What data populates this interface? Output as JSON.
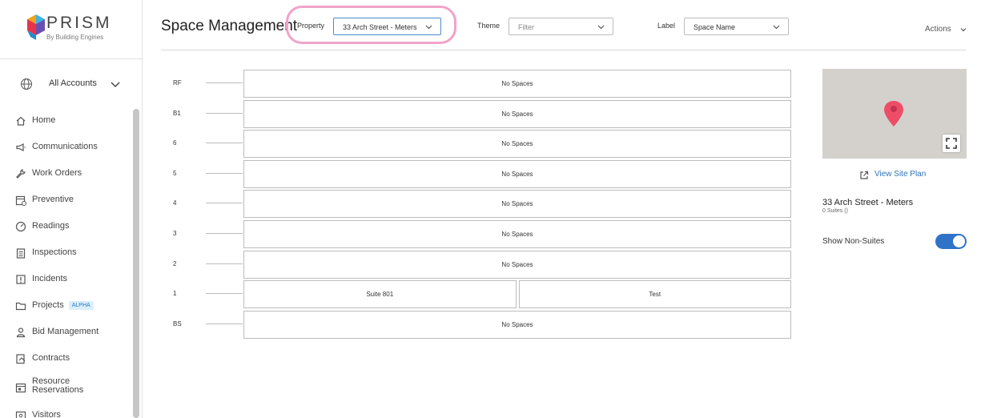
{
  "logo": {
    "name": "PRISM",
    "tagline": "By Building Engines"
  },
  "accounts": {
    "label": "All Accounts"
  },
  "nav": [
    {
      "label": "Home",
      "icon": "home-icon"
    },
    {
      "label": "Communications",
      "icon": "megaphone-icon"
    },
    {
      "label": "Work Orders",
      "icon": "wrench-icon"
    },
    {
      "label": "Preventive",
      "icon": "calendar-check-icon"
    },
    {
      "label": "Readings",
      "icon": "gauge-icon"
    },
    {
      "label": "Inspections",
      "icon": "clipboard-icon"
    },
    {
      "label": "Incidents",
      "icon": "alert-box-icon"
    },
    {
      "label": "Projects",
      "icon": "folder-icon",
      "badge": "ALPHA"
    },
    {
      "label": "Bid Management",
      "icon": "person-icon"
    },
    {
      "label": "Contracts",
      "icon": "contract-icon"
    },
    {
      "label": "Resource Reservations",
      "icon": "reservation-icon"
    },
    {
      "label": "Visitors",
      "icon": "visitor-icon"
    }
  ],
  "header": {
    "title": "Space Management",
    "property_label": "Property",
    "property_value": "33 Arch Street - Meters",
    "theme_label": "Theme",
    "theme_placeholder": "Filter",
    "label_label": "Label",
    "label_value": "Space Name",
    "actions": "Actions"
  },
  "floors": [
    {
      "name": "RF",
      "spaces": [
        "No Spaces"
      ]
    },
    {
      "name": "B1",
      "spaces": [
        "No Spaces"
      ]
    },
    {
      "name": "6",
      "spaces": [
        "No Spaces"
      ]
    },
    {
      "name": "5",
      "spaces": [
        "No Spaces"
      ]
    },
    {
      "name": "4",
      "spaces": [
        "No Spaces"
      ]
    },
    {
      "name": "3",
      "spaces": [
        "No Spaces"
      ]
    },
    {
      "name": "2",
      "spaces": [
        "No Spaces"
      ]
    },
    {
      "name": "1",
      "spaces": [
        "Suite 801",
        "Test"
      ]
    },
    {
      "name": "BS",
      "spaces": [
        "No Spaces"
      ]
    }
  ],
  "panel": {
    "view_site_plan": "View Site Plan",
    "property_name": "33 Arch Street - Meters",
    "suites": "0 Suites ()",
    "show_non_suites": "Show Non-Suites",
    "show_non_suites_on": true
  },
  "colors": {
    "accent": "#2f73c9",
    "highlight": "#f0a3c8",
    "pin": "#ee4d67",
    "map_bg": "#d4d1cc"
  }
}
